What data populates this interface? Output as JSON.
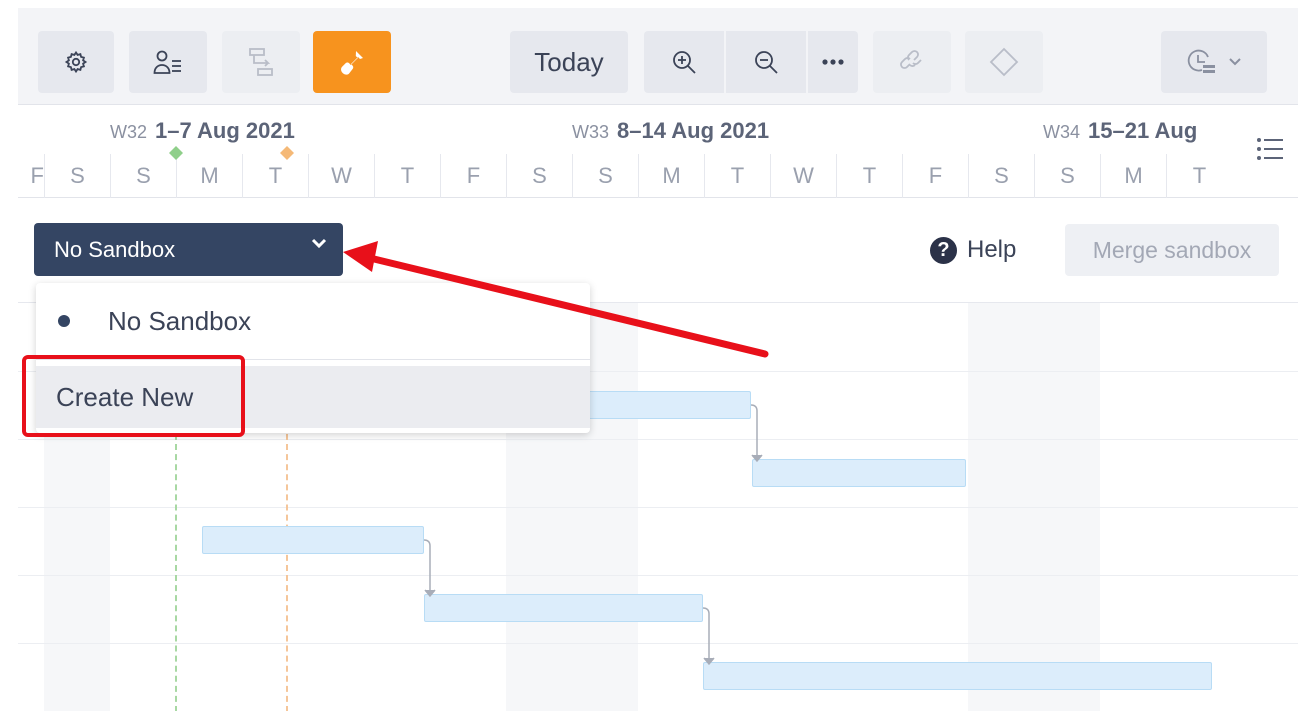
{
  "toolbar": {
    "buttons": [
      {
        "name": "settings",
        "icon": "gear-icon",
        "enabled": true
      },
      {
        "name": "resources",
        "icon": "resource-list-icon",
        "enabled": true
      },
      {
        "name": "dependencies",
        "icon": "dependency-icon",
        "enabled": false
      },
      {
        "name": "sandbox",
        "icon": "shovel-icon",
        "active": true,
        "color": "#f7931e"
      }
    ],
    "today_label": "Today",
    "zoom_in_icon": "zoom-in-icon",
    "zoom_out_icon": "zoom-out-icon",
    "more_icon": "more-dots-icon",
    "link_icon": "link-icon",
    "milestone_icon": "diamond-icon",
    "time_icon": "clock-icon"
  },
  "timeline": {
    "weeks": [
      {
        "number": "W32",
        "range": "1–7 Aug 2021"
      },
      {
        "number": "W33",
        "range": "8–14 Aug 2021"
      },
      {
        "number": "W34",
        "range": "15–21 Aug"
      }
    ],
    "days": [
      "S",
      "S",
      "M",
      "T",
      "W",
      "T",
      "F",
      "S",
      "S",
      "M",
      "T",
      "W",
      "T",
      "F",
      "S",
      "S",
      "M",
      "T"
    ],
    "cut_day": "F"
  },
  "sandbox": {
    "selected": "No Sandbox",
    "options": [
      "No Sandbox"
    ],
    "create_label": "Create New",
    "color": "#344563"
  },
  "help_label": "Help",
  "merge_label": "Merge sandbox",
  "accent": {
    "annotation_red": "#e8101a",
    "bar_fill": "#dcedfb"
  }
}
